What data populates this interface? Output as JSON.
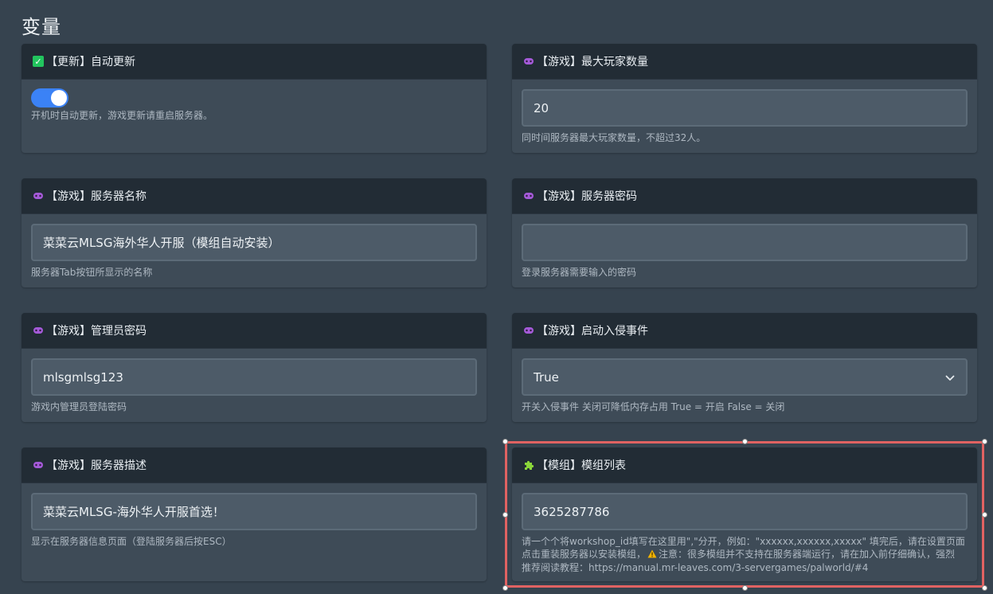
{
  "page": {
    "title": "变量"
  },
  "colors": {
    "background": "#36434f",
    "card": "#3e4b57",
    "card_header": "#222c35",
    "input": "#4d5b68",
    "toggle_on": "#3b82f6",
    "selection": "#e06262"
  },
  "cards": {
    "auto_update": {
      "icon": "checkbox-icon",
      "title": "【更新】自动更新",
      "toggle_on": true,
      "help": "开机时自动更新，游戏更新请重启服务器。"
    },
    "max_players": {
      "icon": "gamepad-icon",
      "title": "【游戏】最大玩家数量",
      "value": "20",
      "help": "同时间服务器最大玩家数量，不超过32人。"
    },
    "server_name": {
      "icon": "gamepad-icon",
      "title": "【游戏】服务器名称",
      "value": "菜菜云MLSG海外华人开服（模组自动安装）",
      "help": "服务器Tab按钮所显示的名称"
    },
    "server_password": {
      "icon": "gamepad-icon",
      "title": "【游戏】服务器密码",
      "value": "",
      "help": "登录服务器需要输入的密码"
    },
    "admin_password": {
      "icon": "gamepad-icon",
      "title": "【游戏】管理员密码",
      "value": "mlsgmlsg123",
      "help": "游戏内管理员登陆密码"
    },
    "invasion_events": {
      "icon": "gamepad-icon",
      "title": "【游戏】启动入侵事件",
      "value": "True",
      "help": "开关入侵事件 关闭可降低内存占用 True = 开启 False = 关闭"
    },
    "server_description": {
      "icon": "gamepad-icon",
      "title": "【游戏】服务器描述",
      "value": "菜菜云MLSG-海外华人开服首选！",
      "help": "显示在服务器信息页面（登陆服务器后按ESC）"
    },
    "mod_list": {
      "icon": "puzzle-icon",
      "title": "【模组】模组列表",
      "value": "3625287786",
      "help_line1": "请一个个将workshop_id填写在这里用\",\"分开，例如：\"xxxxxx,xxxxxx,xxxxx\" 填完后，请在设置页面",
      "help_line2_a": "点击重装服务器以安装模组，",
      "help_warning_icon": "warning-icon",
      "help_line2_b": "注意：很多模组并不支持在服务器端运行，请在加入前仔细确认，强烈",
      "help_line3": "推荐阅读教程：https://manual.mr-leaves.com/3-servergames/palworld/#4"
    }
  }
}
